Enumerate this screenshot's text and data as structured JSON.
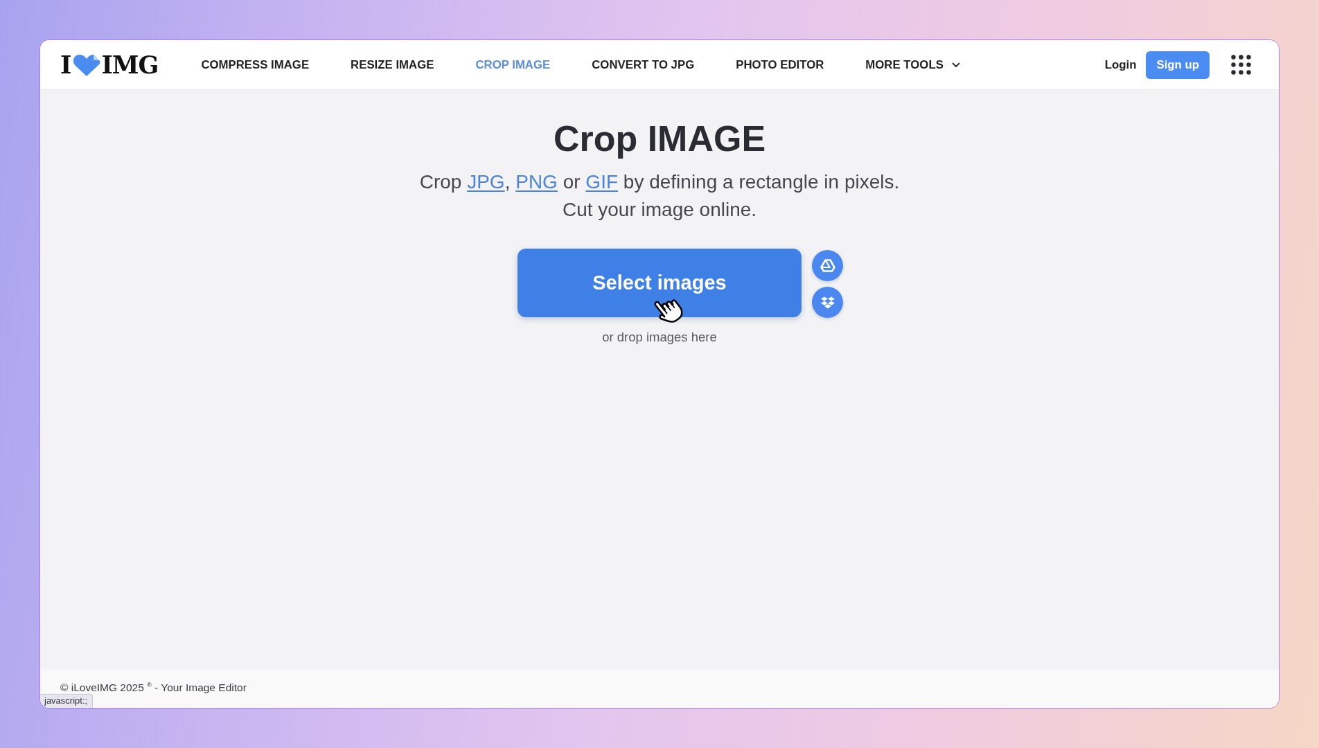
{
  "header": {
    "logo": {
      "left": "I",
      "right": "IMG"
    },
    "nav": [
      {
        "label": "COMPRESS IMAGE",
        "kind": "link",
        "selected": false
      },
      {
        "label": "RESIZE IMAGE",
        "kind": "link",
        "selected": false
      },
      {
        "label": "CROP IMAGE",
        "kind": "link",
        "selected": true
      },
      {
        "label": "CONVERT TO JPG",
        "kind": "link",
        "selected": false
      },
      {
        "label": "PHOTO EDITOR",
        "kind": "link",
        "selected": false
      },
      {
        "label": "MORE TOOLS",
        "kind": "dropdown",
        "selected": false
      }
    ],
    "login": "Login",
    "signup": "Sign up"
  },
  "hero": {
    "title": "Crop IMAGE",
    "description": [
      {
        "kind": "text",
        "text": "Crop "
      },
      {
        "kind": "link",
        "text": "JPG"
      },
      {
        "kind": "text",
        "text": ", "
      },
      {
        "kind": "link",
        "text": "PNG"
      },
      {
        "kind": "text",
        "text": " or "
      },
      {
        "kind": "link",
        "text": "GIF"
      },
      {
        "kind": "text",
        "text": " by defining a rectangle in pixels."
      }
    ],
    "tagline": "Cut your image online.",
    "upload_button": "Select images",
    "drop_hint": "or drop images here"
  },
  "footer": {
    "copyright": "© iLoveIMG 2025 $^{®}$ - Your Image Editor"
  },
  "status_bar": {
    "url": "javascript:;"
  }
}
